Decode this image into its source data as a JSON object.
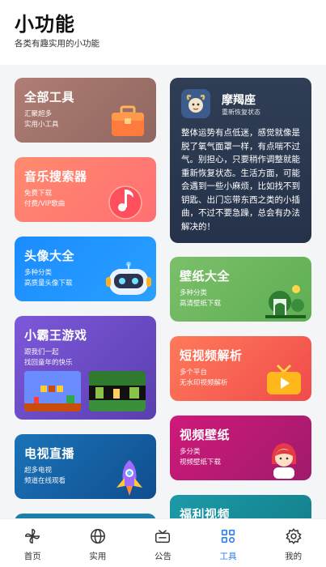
{
  "header": {
    "title": "小功能",
    "subtitle": "各类有趣实用的小功能"
  },
  "cards": {
    "tools": {
      "title": "全部工具",
      "line1": "汇聚超多",
      "line2": "实用小工具"
    },
    "music": {
      "title": "音乐搜索器",
      "line1": "免费下载",
      "line2": "付费/VIP歌曲"
    },
    "avatar": {
      "title": "头像大全",
      "line1": "多种分类",
      "line2": "高质量头像下载"
    },
    "game": {
      "title": "小霸王游戏",
      "line1": "跟我们一起",
      "line2": "找回童年的快乐"
    },
    "tv": {
      "title": "电视直播",
      "line1": "超多电视",
      "line2": "频道在线观看"
    },
    "horoscope": {
      "name": "摩羯座",
      "status": "重新恢复状态",
      "text": "整体运势有点低迷，感觉就像是脱了氧气面罩一样，有点喘不过气。别担心，只要稍作调整就能重新恢复状态。生活方面，可能会遇到一些小麻烦，比如找不到钥匙、出门忘带东西之类的小插曲，不过不要急躁，总会有办法解决的！"
    },
    "wallpaper": {
      "title": "壁纸大全",
      "line1": "多种分类",
      "line2": "高清壁纸下载"
    },
    "short_video": {
      "title": "短视频解析",
      "line1": "多个平台",
      "line2": "无水印视频解析"
    },
    "video_wallpaper": {
      "title": "视频壁纸",
      "line1": "多分类",
      "line2": "视频壁纸下载"
    },
    "welfare": {
      "title": "福利视频"
    }
  },
  "nav": {
    "items": [
      {
        "label": "首页",
        "icon": "pinwheel-icon"
      },
      {
        "label": "实用",
        "icon": "globe-icon"
      },
      {
        "label": "公告",
        "icon": "notice-icon"
      },
      {
        "label": "工具",
        "icon": "grid-icon"
      },
      {
        "label": "我的",
        "icon": "gear-icon"
      }
    ],
    "active_index": 3,
    "active_color": "#2d7ff0"
  }
}
